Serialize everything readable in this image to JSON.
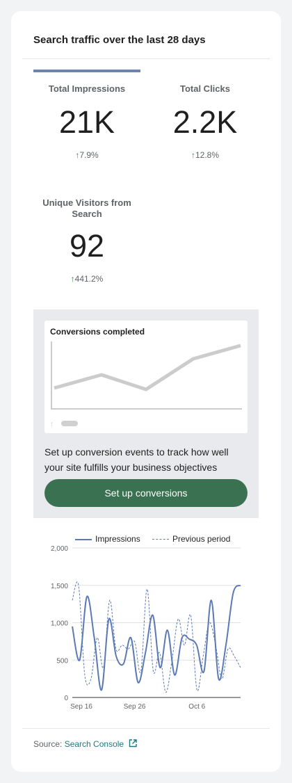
{
  "card": {
    "title": "Search traffic over the last 28 days"
  },
  "metrics": [
    {
      "label": "Total Impressions",
      "value": "21K",
      "change": "7.9%"
    },
    {
      "label": "Total Clicks",
      "value": "2.2K",
      "change": "12.8%"
    },
    {
      "label_line1": "Unique Visitors from",
      "label_line2": "Search",
      "value": "92",
      "change": "441.2%"
    }
  ],
  "conversions": {
    "card_title": "Conversions completed",
    "description_line1": "Set up conversion events to track how well",
    "description_line2": "your site fulfills your business objectives",
    "button_label": "Set up conversions"
  },
  "colors": {
    "accent_tab": "#6f84ad",
    "positive_arrow": "#3a7d44",
    "primary_button": "#3a7151",
    "series_impressions": "#5b79b5",
    "link": "#197a7a"
  },
  "chart_data": {
    "type": "line",
    "title": "",
    "xlabel": "",
    "ylabel": "",
    "ylim": [
      0,
      2000
    ],
    "yticks": [
      "0",
      "500",
      "1,000",
      "1,500",
      "2,000"
    ],
    "xticks": [
      "Sep 16",
      "Sep 26",
      "Oct 6"
    ],
    "xtick_index": [
      0,
      10,
      20
    ],
    "legend_position": "top",
    "series": [
      {
        "name": "Impressions",
        "style": "solid",
        "values": [
          950,
          500,
          1350,
          800,
          100,
          1050,
          550,
          450,
          800,
          200,
          600,
          1100,
          400,
          900,
          300,
          800,
          780,
          700,
          350,
          1300,
          250,
          700,
          1400,
          1500
        ]
      },
      {
        "name": "Previous period",
        "style": "dashed",
        "values": [
          1300,
          1500,
          300,
          250,
          800,
          400,
          1300,
          650,
          700,
          650,
          750,
          350,
          1450,
          350,
          600,
          70,
          500,
          1050,
          700,
          1100,
          100,
          550,
          1000,
          700,
          250,
          650,
          550,
          400
        ]
      }
    ]
  },
  "footer": {
    "source_label": "Source:",
    "link_label": "Search Console"
  }
}
